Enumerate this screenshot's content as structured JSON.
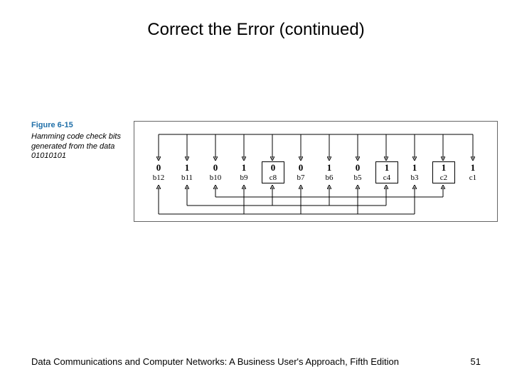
{
  "title": "Correct the Error (continued)",
  "figure": {
    "number": "Figure 6-15",
    "caption": "Hamming code check bits generated from the data 01010101"
  },
  "bits": [
    {
      "value": "0",
      "label": "b12",
      "kind": "data"
    },
    {
      "value": "1",
      "label": "b11",
      "kind": "data"
    },
    {
      "value": "0",
      "label": "b10",
      "kind": "data"
    },
    {
      "value": "1",
      "label": "b9",
      "kind": "data"
    },
    {
      "value": "0",
      "label": "c8",
      "kind": "check"
    },
    {
      "value": "0",
      "label": "b7",
      "kind": "data"
    },
    {
      "value": "1",
      "label": "b6",
      "kind": "data"
    },
    {
      "value": "0",
      "label": "b5",
      "kind": "data"
    },
    {
      "value": "1",
      "label": "c4",
      "kind": "check"
    },
    {
      "value": "1",
      "label": "b3",
      "kind": "data"
    },
    {
      "value": "1",
      "label": "c2",
      "kind": "check"
    },
    {
      "value": "1",
      "label": "c1",
      "kind": "check"
    }
  ],
  "footer": {
    "text": "Data Communications and Computer Networks: A Business User's Approach, Fifth Edition",
    "page": "51"
  },
  "chart_data": {
    "type": "diagram",
    "description": "Hamming(12,8) code layout showing 8 data bits (b12..b9,b7..b5,b3) with value 01010101 and 4 generated check bits (c8=0,c4=1,c2=1,c1=1). Arrows above indicate which data bits feed into check-bit computation from the row above; arrows below indicate additional parity relationships.",
    "data_bits_input": "01010101",
    "positions": [
      "b12",
      "b11",
      "b10",
      "b9",
      "c8",
      "b7",
      "b6",
      "b5",
      "c4",
      "b3",
      "c2",
      "c1"
    ],
    "values": [
      "0",
      "1",
      "0",
      "1",
      "0",
      "0",
      "1",
      "0",
      "1",
      "1",
      "1",
      "1"
    ],
    "check_bits": {
      "c8": "0",
      "c4": "1",
      "c2": "1",
      "c1": "1"
    }
  }
}
